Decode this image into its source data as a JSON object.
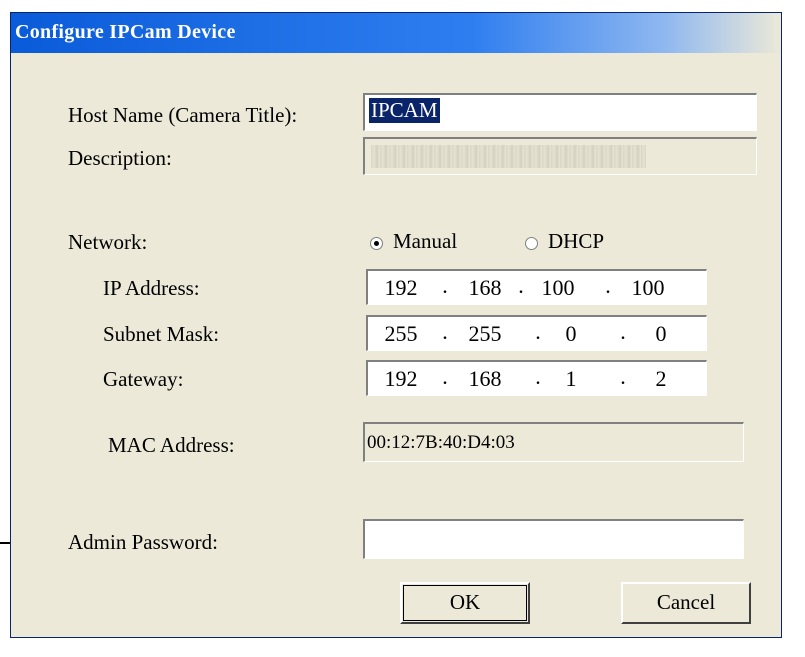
{
  "window": {
    "title": "Configure IPCam Device"
  },
  "labels": {
    "host_name": "Host Name (Camera Title):",
    "description": "Description:",
    "network": "Network:",
    "ip_address": "IP Address:",
    "subnet_mask": "Subnet Mask:",
    "gateway": "Gateway:",
    "mac_address": "MAC Address:",
    "admin_password": "Admin Password:"
  },
  "fields": {
    "host_name": "IPCAM",
    "description": "",
    "mac_address": "00:12:7B:40:D4:03",
    "admin_password": ""
  },
  "network": {
    "manual_label": "Manual",
    "dhcp_label": "DHCP",
    "selected": "Manual"
  },
  "ip_address": [
    "192",
    "168",
    "100",
    "100"
  ],
  "subnet_mask": [
    "255",
    "255",
    "0",
    "0"
  ],
  "gateway": [
    "192",
    "168",
    "1",
    "2"
  ],
  "buttons": {
    "ok": "OK",
    "cancel": "Cancel"
  },
  "colors": {
    "title_bar": "#0a5bd9",
    "dialog_bg": "#ece9d8",
    "selection": "#0a246a"
  }
}
